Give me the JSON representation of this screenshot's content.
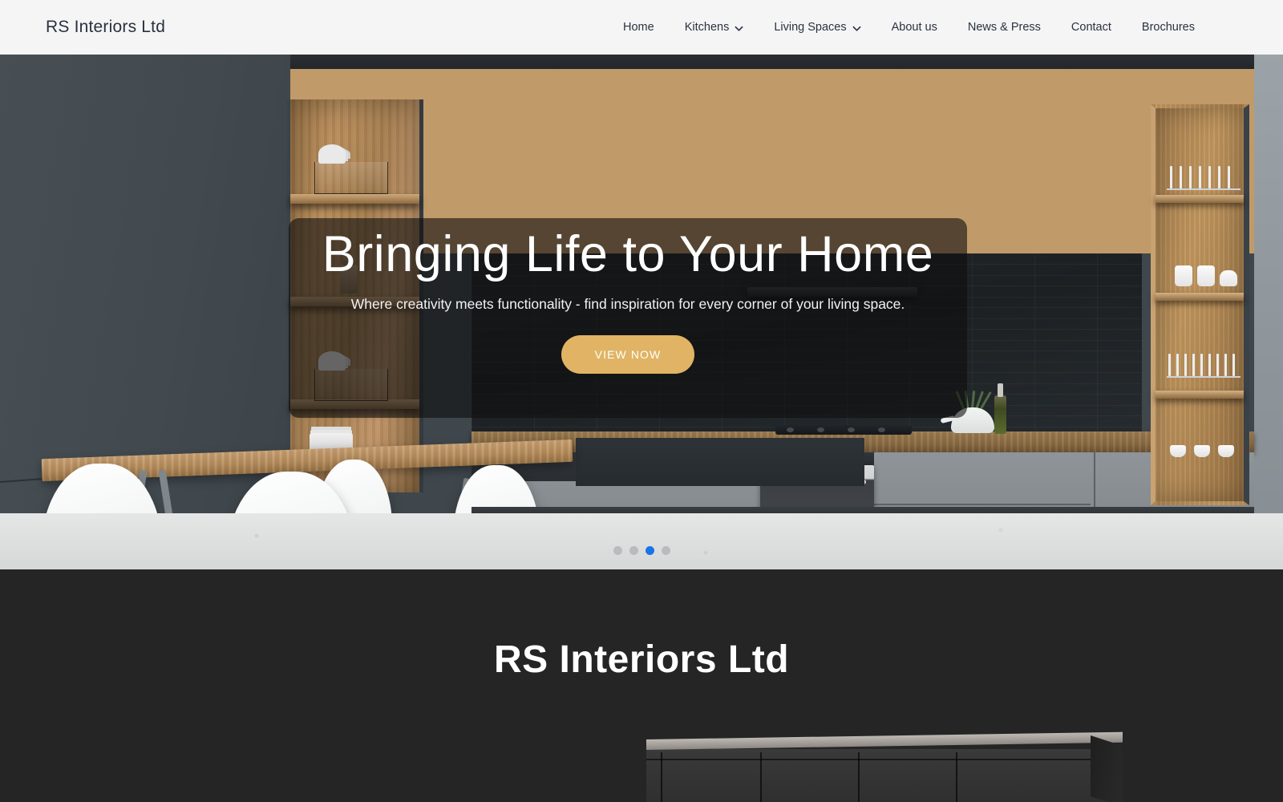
{
  "header": {
    "brand": "RS Interiors Ltd",
    "nav": [
      {
        "label": "Home",
        "has_dropdown": false
      },
      {
        "label": "Kitchens",
        "has_dropdown": true
      },
      {
        "label": "Living Spaces",
        "has_dropdown": true
      },
      {
        "label": "About us",
        "has_dropdown": false
      },
      {
        "label": "News & Press",
        "has_dropdown": false
      },
      {
        "label": "Contact",
        "has_dropdown": false
      },
      {
        "label": "Brochures",
        "has_dropdown": false
      }
    ]
  },
  "hero": {
    "title": "Bringing Life to Your Home",
    "subtitle": "Where creativity meets functionality - find inspiration for every corner of your living space.",
    "cta_label": "VIEW NOW",
    "cta_color": "#e0b464",
    "slides_total": 4,
    "active_slide": 3,
    "active_dot_color": "#1a73e8",
    "inactive_dot_color": "#b9bcbf"
  },
  "dark_section": {
    "title": "RS Interiors Ltd",
    "background": "#252525"
  }
}
